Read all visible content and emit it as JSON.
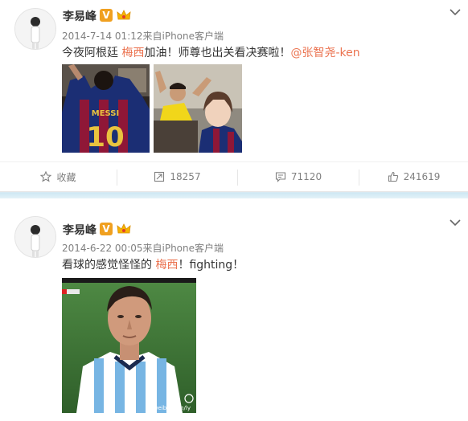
{
  "posts": [
    {
      "user_name": "李易峰",
      "verified_badge": "V",
      "meta": "2014-7-14 01:12来自iPhone客户端",
      "text_a": "今夜阿根廷 ",
      "text_red": "梅西",
      "text_b": "加油！师尊也出关看决赛啦！",
      "mention": "@张智尧-ken",
      "photo_left_jersey_name": "MESSI",
      "photo_left_jersey_number": "10",
      "actions": {
        "favorite_label": "收藏",
        "repost_count": "18257",
        "comment_count": "71120",
        "like_count": "241619"
      }
    },
    {
      "user_name": "李易峰",
      "verified_badge": "V",
      "meta": "2014-6-22 00:05来自iPhone客户端",
      "text_a": "看球的感觉怪怪的 ",
      "text_red": "梅西",
      "text_b": "！fighting！",
      "image_watermark": "weibo.com/ly"
    }
  ],
  "colors": {
    "highlight": "#eb7350",
    "divider_band": "#d6ebf4",
    "badge": "#f0a020"
  },
  "icons": [
    "avatar",
    "verified-badge-icon",
    "crown-icon",
    "chevron-down-icon",
    "star-icon",
    "repost-icon",
    "comment-icon",
    "like-icon"
  ]
}
